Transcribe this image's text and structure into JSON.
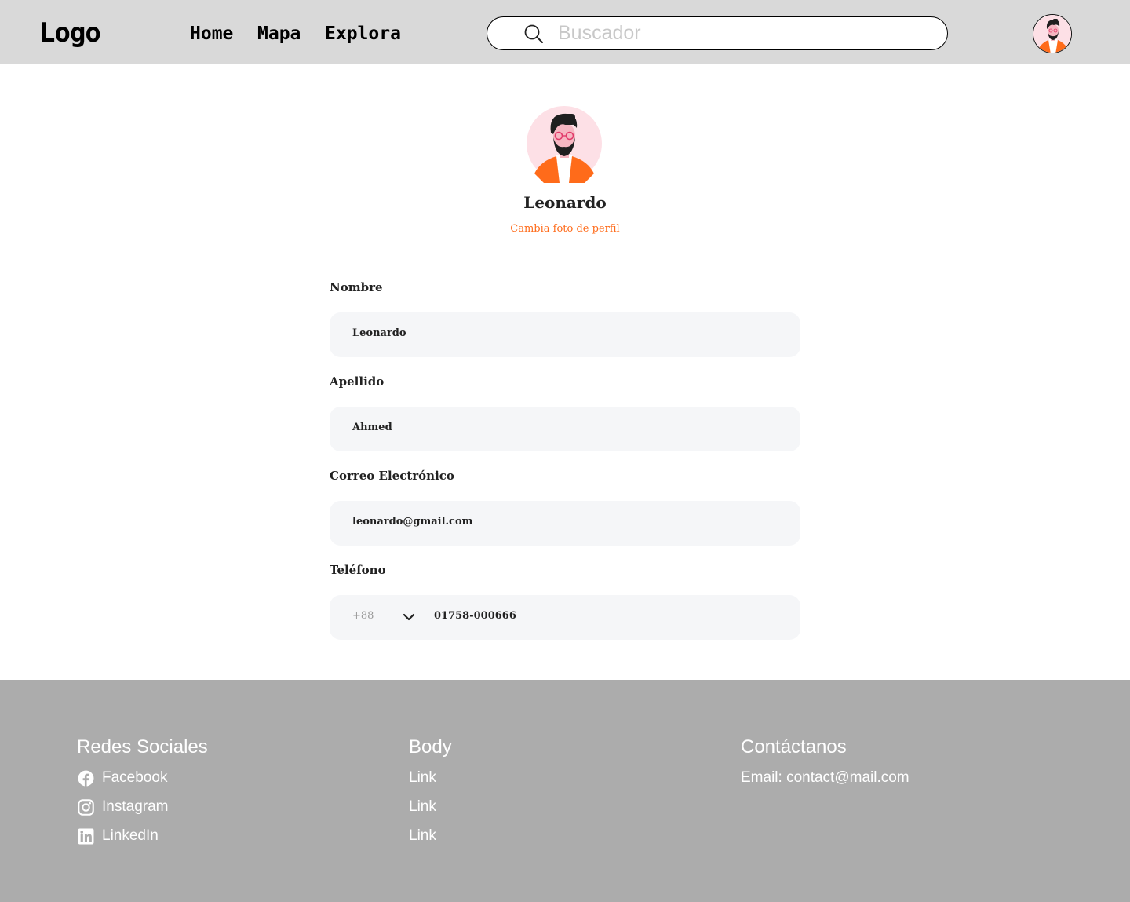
{
  "header": {
    "logo": "Logo",
    "nav": [
      {
        "label": "Home"
      },
      {
        "label": "Mapa"
      },
      {
        "label": "Explora"
      }
    ],
    "search": {
      "placeholder": "Buscador",
      "icon": "search-icon"
    },
    "avatar_icon": "avatar"
  },
  "profile": {
    "name": "Leonardo",
    "change_photo": "Cambia foto de perfil",
    "accent_color": "#ff6b1a"
  },
  "form": {
    "nombre": {
      "label": "Nombre",
      "value": "Leonardo"
    },
    "apellido": {
      "label": "Apellido",
      "value": "Ahmed"
    },
    "correo": {
      "label": "Correo Electrónico",
      "value": "leonardo@gmail.com"
    },
    "telefono": {
      "label": "Teléfono",
      "country_code": "+88",
      "value": "01758-000666",
      "dropdown_icon": "chevron-down-icon"
    }
  },
  "footer": {
    "redes": {
      "title": "Redes Sociales",
      "items": [
        {
          "label": "Facebook",
          "icon": "facebook-icon"
        },
        {
          "label": "Instagram",
          "icon": "instagram-icon"
        },
        {
          "label": "LinkedIn",
          "icon": "linkedin-icon"
        }
      ]
    },
    "body": {
      "title": "Body",
      "links": [
        {
          "label": "Link"
        },
        {
          "label": "Link"
        },
        {
          "label": "Link"
        }
      ]
    },
    "contacto": {
      "title": "Contáctanos",
      "email": "Email: contact@mail.com"
    }
  }
}
